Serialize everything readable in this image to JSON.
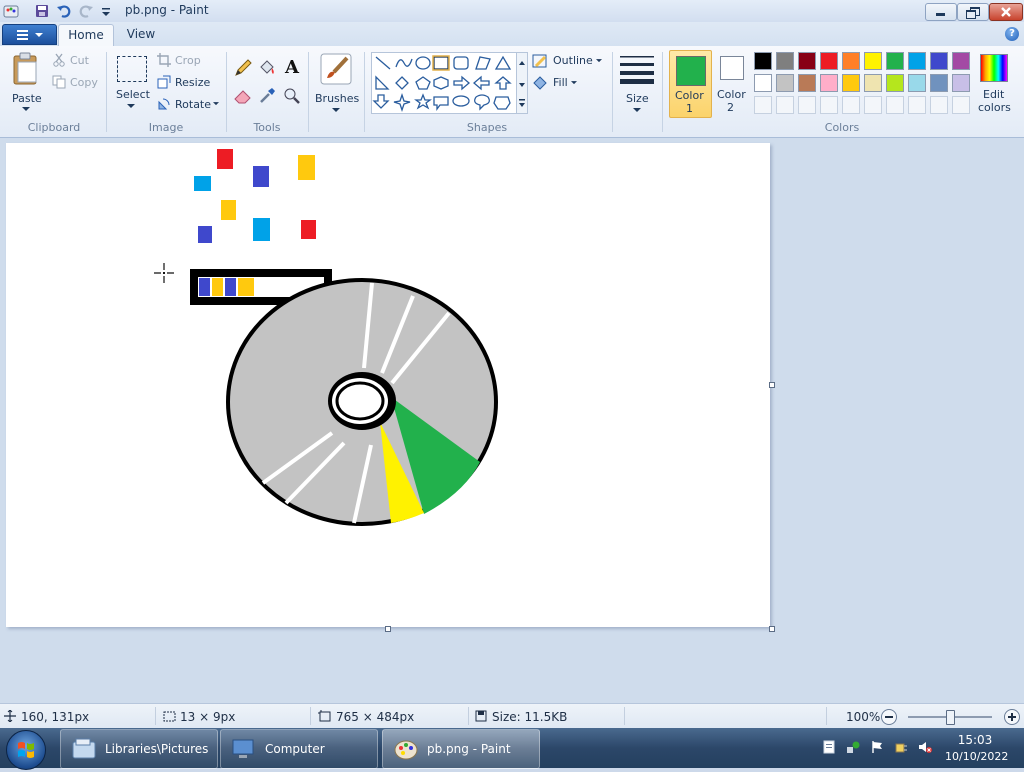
{
  "window": {
    "title": "pb.png - Paint"
  },
  "tabs": {
    "home": "Home",
    "view": "View"
  },
  "clipboard": {
    "paste": "Paste",
    "cut": "Cut",
    "copy": "Copy",
    "group": "Clipboard"
  },
  "image": {
    "select": "Select",
    "crop": "Crop",
    "resize": "Resize",
    "rotate": "Rotate",
    "group": "Image"
  },
  "tools": {
    "group": "Tools"
  },
  "brushes": {
    "label": "Brushes"
  },
  "shapes": {
    "outline": "Outline",
    "fill": "Fill",
    "group": "Shapes"
  },
  "size": {
    "label": "Size"
  },
  "colors": {
    "color1_label_1": "Color",
    "color1_label_2": "1",
    "color2_label_1": "Color",
    "color2_label_2": "2",
    "edit_label_1": "Edit",
    "edit_label_2": "colors",
    "group": "Colors",
    "color1": "#22b14c",
    "color2": "#ffffff",
    "palette_row1": [
      "#000000",
      "#7f7f7f",
      "#880015",
      "#ed1c24",
      "#ff7f27",
      "#fff200",
      "#22b14c",
      "#00a2e8",
      "#3f48cc",
      "#a349a4"
    ],
    "palette_row2": [
      "#ffffff",
      "#c3c3c3",
      "#b97a57",
      "#ffaec9",
      "#ffc90e",
      "#efe4b0",
      "#b5e61d",
      "#99d9ea",
      "#7092be",
      "#c8bfe7"
    ]
  },
  "status": {
    "cursor_pos": "160, 131px",
    "selection_size": "13 × 9px",
    "image_size": "765 × 484px",
    "file_size": "Size: 11.5KB",
    "zoom": "100%",
    "zoom_level": 1.0
  },
  "taskbar": {
    "items": [
      {
        "label": "Libraries\\Pictures"
      },
      {
        "label": "Computer"
      },
      {
        "label": "pb.png - Paint"
      }
    ],
    "time": "15:03",
    "date": "10/10/2022"
  }
}
